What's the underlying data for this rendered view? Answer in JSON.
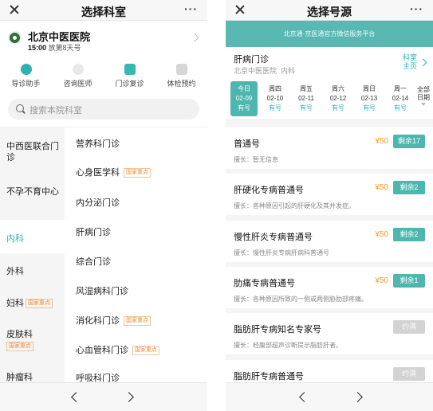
{
  "left": {
    "title": "选择科室",
    "more": "···",
    "hospital": {
      "name": "北京中医医院",
      "time": "15:00",
      "status": "放第8天号"
    },
    "quick": [
      {
        "label": "导诊助手"
      },
      {
        "label": "咨询医师"
      },
      {
        "label": "门诊复诊"
      },
      {
        "label": "体检预约"
      }
    ],
    "search_placeholder": "搜索本院科室",
    "categories": [
      {
        "label": "中西医联合门诊",
        "tag": ""
      },
      {
        "label": "不孕不育中心",
        "tag": ""
      },
      {
        "label": "内科",
        "tag": ""
      },
      {
        "label": "外科",
        "tag": ""
      },
      {
        "label": "妇科",
        "tag": "国家重点"
      },
      {
        "label": "皮肤科",
        "tag": "国家重点"
      },
      {
        "label": "肿瘤科",
        "tag": ""
      }
    ],
    "subs": [
      {
        "label": "营养科门诊",
        "tag": ""
      },
      {
        "label": "心身医学科",
        "tag": "国家重点"
      },
      {
        "label": "内分泌门诊",
        "tag": ""
      },
      {
        "label": "肝病门诊",
        "tag": ""
      },
      {
        "label": "综合门诊",
        "tag": ""
      },
      {
        "label": "风湿病科门诊",
        "tag": ""
      },
      {
        "label": "消化科门诊",
        "tag": "国家重点"
      },
      {
        "label": "心血管科门诊",
        "tag": "国家重点"
      },
      {
        "label": "呼吸科门诊",
        "tag": ""
      }
    ]
  },
  "right": {
    "title": "选择号源",
    "more": "···",
    "banner": "北京通·京医通官方微信服务平台",
    "dept": {
      "name": "肝病门诊",
      "hospital": "北京中医医院",
      "category": "内科",
      "home_line1": "科室",
      "home_line2": "主页"
    },
    "dates": [
      {
        "day": "今日",
        "date": "02-09",
        "status": "有号"
      },
      {
        "day": "周四",
        "date": "02-10",
        "status": "有号"
      },
      {
        "day": "周五",
        "date": "02-11",
        "status": "有号"
      },
      {
        "day": "周六",
        "date": "02-12",
        "status": "有号"
      },
      {
        "day": "周日",
        "date": "02-13",
        "status": "有号"
      },
      {
        "day": "周一",
        "date": "02-14",
        "status": "有号"
      }
    ],
    "all_dates": {
      "line1": "全部",
      "line2": "日期"
    },
    "slots": [
      {
        "name": "普通号",
        "desc": "擅长：暂无信息",
        "price": "¥50",
        "button": "剩余17",
        "full": false
      },
      {
        "name": "肝硬化专病普通号",
        "desc": "擅长：各种原因引起的肝硬化及其并发症。",
        "price": "¥50",
        "button": "剩余2",
        "full": false
      },
      {
        "name": "慢性肝炎专病普通号",
        "desc": "擅长：慢性肝炎专病肝病科普通号",
        "price": "¥50",
        "button": "剩余2",
        "full": false
      },
      {
        "name": "肋痛专病普通号",
        "desc": "擅长：各种原因所致的一侧或两侧胁肋部疼痛。",
        "price": "¥50",
        "button": "剩余1",
        "full": false
      },
      {
        "name": "脂肪肝专病知名专家号",
        "desc": "擅长：经腹部超声诊断提示脂肪肝者。",
        "price": "",
        "button": "约满",
        "full": true
      },
      {
        "name": "脂肪肝专病普通号",
        "desc": "",
        "price": "",
        "button": "约满",
        "full": true
      }
    ]
  },
  "colors": {
    "accent": "#2fb3b0",
    "banner": "#5ab8b3",
    "price": "#f39b2b",
    "tag": "#e88a3a"
  }
}
